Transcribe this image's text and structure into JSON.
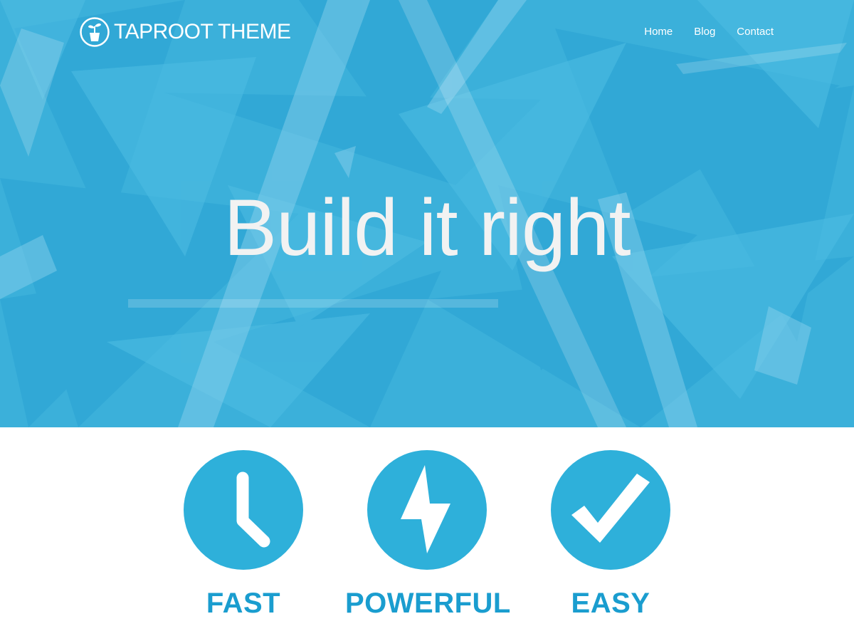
{
  "colors": {
    "hero_background": "#3bb0da",
    "accent": "#2eb0da",
    "feature_label": "#1a9dcf",
    "hero_title": "#f2f2f2",
    "header_text": "#ffffff"
  },
  "header": {
    "brand_name": "TAPROOT THEME",
    "logo_icon": "potted-plant-icon"
  },
  "nav": {
    "items": [
      {
        "label": "Home"
      },
      {
        "label": "Blog"
      },
      {
        "label": "Contact"
      }
    ]
  },
  "hero": {
    "title": "Build it right"
  },
  "features": [
    {
      "label": "FAST",
      "icon": "clock-icon"
    },
    {
      "label": "POWERFUL",
      "icon": "lightning-bolt-icon"
    },
    {
      "label": "EASY",
      "icon": "checkmark-icon"
    }
  ]
}
